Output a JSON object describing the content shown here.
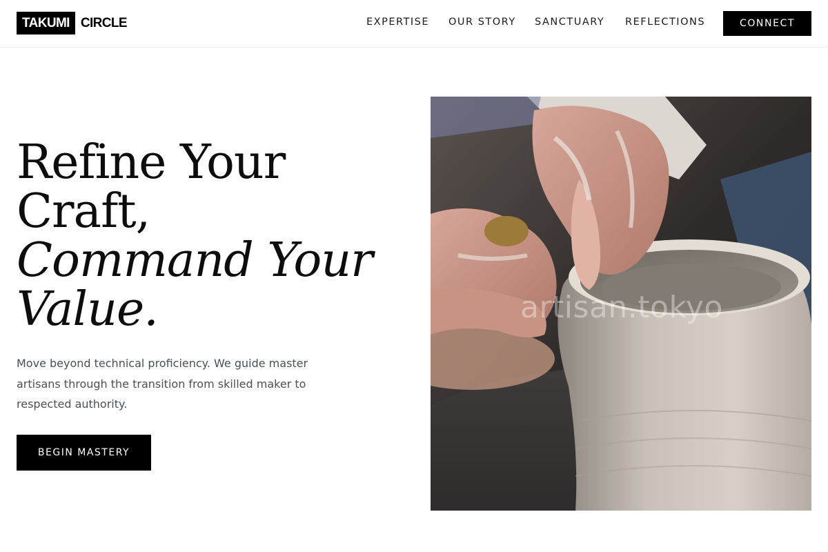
{
  "brand": {
    "logo_box_text": "TAKUMI",
    "logo_text": "CIRCLE"
  },
  "nav": {
    "items": [
      {
        "label": "EXPERTISE"
      },
      {
        "label": "OUR STORY"
      },
      {
        "label": "SANCTUARY"
      },
      {
        "label": "REFLECTIONS"
      }
    ],
    "connect_label": "CONNECT"
  },
  "hero": {
    "headline": {
      "line1": "Refine Your",
      "line2": "Craft,",
      "line3": "Command Your",
      "line4": "Value."
    },
    "subtitle": "Move beyond technical proficiency. We guide master artisans through the transition from skilled maker to respected authority.",
    "cta_label": "BEGIN MASTERY",
    "image": {
      "watermark": "artisan.tokyo",
      "icon": "pottery-wheel-photo"
    }
  },
  "colors": {
    "primary": "#000000",
    "background": "#ffffff",
    "body_text": "#4a4f57"
  }
}
